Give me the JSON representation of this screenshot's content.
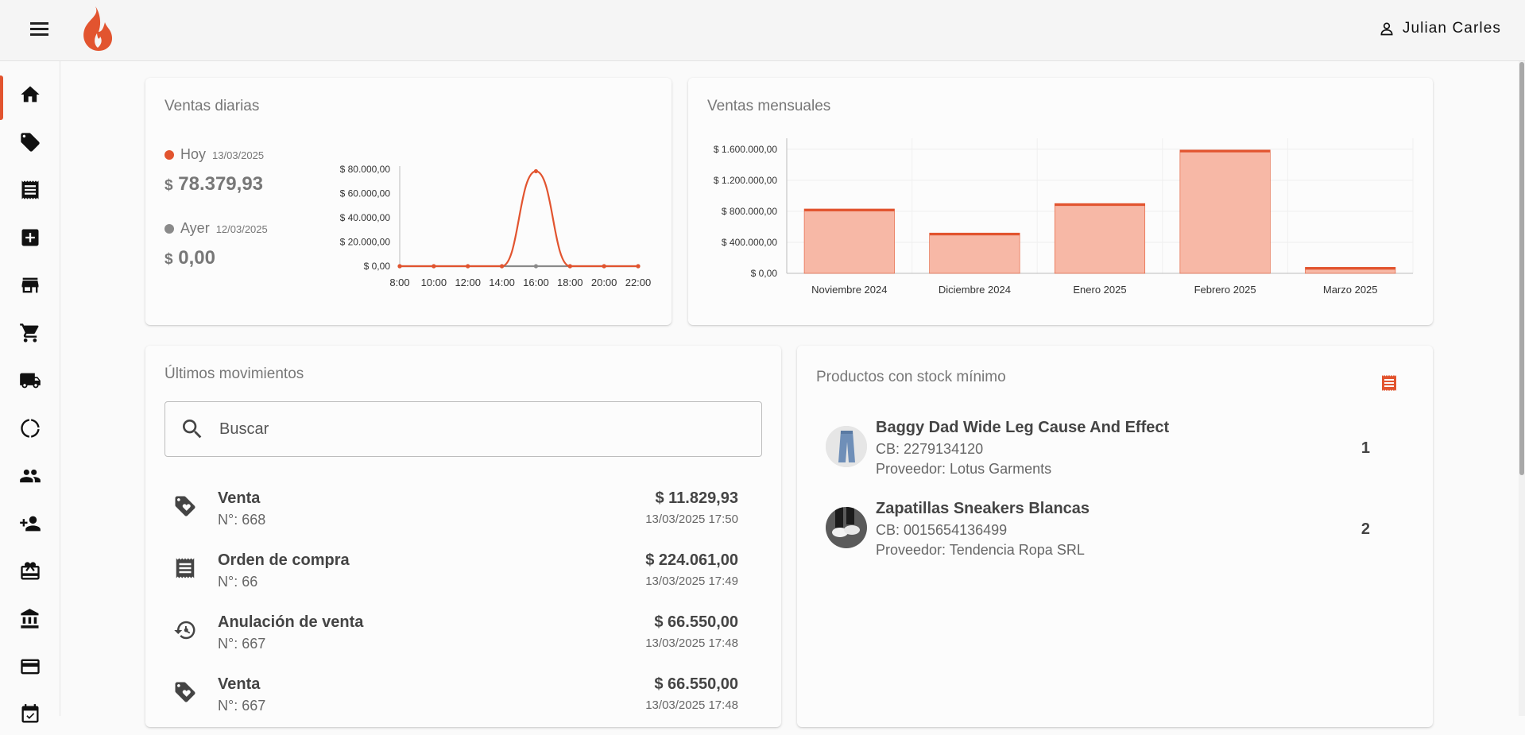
{
  "header": {
    "user_name": "Julian Carles",
    "brand_color": "#e2542f"
  },
  "sidebar": {
    "items": [
      {
        "icon": "home-icon"
      },
      {
        "icon": "tag-icon"
      },
      {
        "icon": "receipt-icon"
      },
      {
        "icon": "add-box-icon"
      },
      {
        "icon": "store-icon"
      },
      {
        "icon": "cart-icon"
      },
      {
        "icon": "truck-icon"
      },
      {
        "icon": "donut-icon"
      },
      {
        "icon": "people-icon"
      },
      {
        "icon": "person-add-icon"
      },
      {
        "icon": "giftcard-icon"
      },
      {
        "icon": "bank-icon"
      },
      {
        "icon": "credit-card-icon"
      },
      {
        "icon": "calendar-icon"
      }
    ]
  },
  "daily_sales": {
    "title": "Ventas diarias",
    "today": {
      "label": "Hoy",
      "date": "13/03/2025",
      "currency": "$",
      "amount": "78.379,93",
      "color": "#e2542f"
    },
    "yesterday": {
      "label": "Ayer",
      "date": "12/03/2025",
      "currency": "$",
      "amount": "0,00",
      "color": "#8a8a8a"
    }
  },
  "monthly_sales": {
    "title": "Ventas mensuales"
  },
  "movements": {
    "title": "Últimos movimientos",
    "search_placeholder": "Buscar",
    "rows": [
      {
        "icon": "tag-icon",
        "type": "Venta",
        "number": "N°: 668",
        "amount": "$ 11.829,93",
        "date": "13/03/2025 17:50"
      },
      {
        "icon": "receipt-icon",
        "type": "Orden de compra",
        "number": "N°: 66",
        "amount": "$ 224.061,00",
        "date": "13/03/2025 17:49"
      },
      {
        "icon": "restore-icon",
        "type": "Anulación de venta",
        "number": "N°: 667",
        "amount": "$ 66.550,00",
        "date": "13/03/2025 17:48"
      },
      {
        "icon": "tag-icon",
        "type": "Venta",
        "number": "N°: 667",
        "amount": "$ 66.550,00",
        "date": "13/03/2025 17:48"
      }
    ]
  },
  "low_stock": {
    "title": "Productos con stock mínimo",
    "products": [
      {
        "name": "Baggy Dad Wide Leg Cause And Effect",
        "barcode": "CB: 2279134120",
        "supplier": "Proveedor: Lotus Garments",
        "qty": "1"
      },
      {
        "name": "Zapatillas Sneakers Blancas",
        "barcode": "CB: 0015654136499",
        "supplier": "Proveedor: Tendencia Ropa SRL",
        "qty": "2"
      }
    ]
  },
  "chart_data": [
    {
      "type": "line",
      "title": "",
      "x": [
        "8:00",
        "10:00",
        "12:00",
        "14:00",
        "16:00",
        "18:00",
        "20:00",
        "22:00"
      ],
      "ylim": [
        0,
        80000
      ],
      "yticks": [
        "$ 0,00",
        "$ 20.000,00",
        "$ 40.000,00",
        "$ 60.000,00",
        "$ 80.000,00"
      ],
      "series": [
        {
          "name": "Hoy",
          "color": "#e2542f",
          "values": [
            0,
            0,
            0,
            0,
            78379.93,
            0,
            0,
            0
          ]
        },
        {
          "name": "Ayer",
          "color": "#8a8a8a",
          "values": [
            0,
            0,
            0,
            0,
            0,
            0,
            0,
            0
          ]
        }
      ],
      "grid": false
    },
    {
      "type": "bar",
      "title": "",
      "categories": [
        "Noviembre 2024",
        "Diciembre 2024",
        "Enero 2025",
        "Febrero 2025",
        "Marzo 2025"
      ],
      "values": [
        830000,
        520000,
        900000,
        1590000,
        78379.93
      ],
      "ylim": [
        0,
        1700000
      ],
      "yticks": [
        "$ 0,00",
        "$ 400.000,00",
        "$ 800.000,00",
        "$ 1.200.000,00",
        "$ 1.600.000,00"
      ],
      "fill_color": "#f7b8a6",
      "edge_color": "#e2542f",
      "grid": true
    }
  ]
}
